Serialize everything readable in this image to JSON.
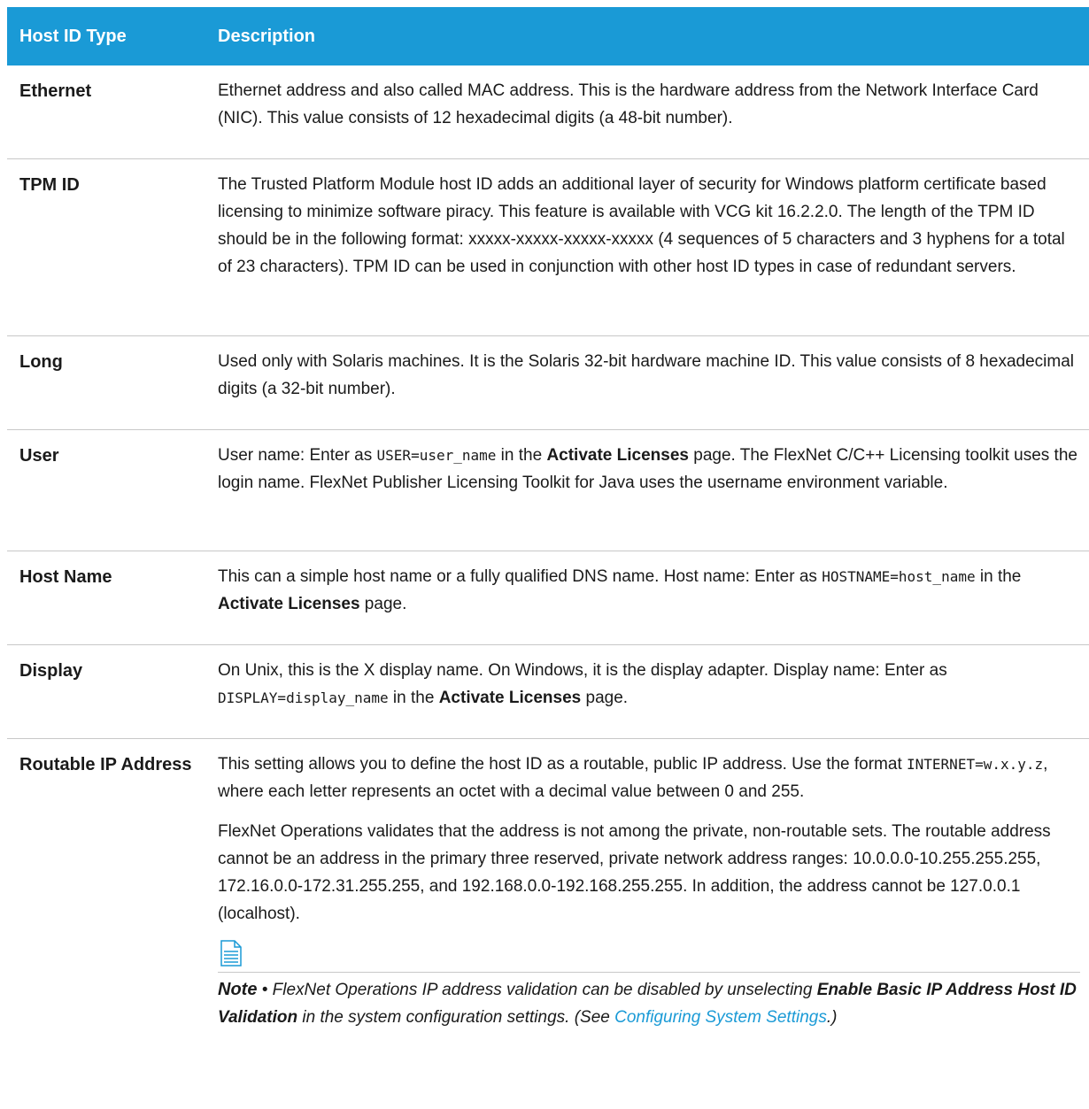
{
  "header": {
    "col1": "Host ID Type",
    "col2": "Description"
  },
  "rows": {
    "ethernet": {
      "type": "Ethernet",
      "desc": "Ethernet address and also called MAC address. This is the hardware address from the Network Interface Card (NIC). This value consists of 12 hexadecimal digits (a 48-bit number)."
    },
    "tpm": {
      "type": "TPM ID",
      "desc_a": "The Trusted Platform Module host ID adds an additional layer of security for Windows platform certificate based licensing to minimize software piracy. This feature is available with VCG kit 16.2.2.0. The length of the TPM ID should be in the following format: ",
      "format": "xxxxx-xxxxx-xxxxx-xxxxx",
      "desc_b": " (4 sequences of 5 characters and 3 hyphens for a total of 23 characters). TPM ID can be used in conjunction with other host ID types in case of redundant servers."
    },
    "long": {
      "type": "Long",
      "desc": "Used only with Solaris machines. It is the Solaris 32-bit hardware machine ID. This value consists of 8 hexadecimal digits (a 32-bit number)."
    },
    "user": {
      "type": "User",
      "desc_a": "User name: Enter as ",
      "code": "USER=user_name",
      "desc_b": "  in the ",
      "bold": "Activate Licenses",
      "desc_c": " page. The FlexNet C/C++ Licensing toolkit uses the login name. FlexNet Publisher Licensing Toolkit for Java uses the username environment variable."
    },
    "hostname": {
      "type": "Host Name",
      "desc_a": "This can a simple host name or a fully qualified DNS name. Host name: Enter as ",
      "code": "HOSTNAME=host_name",
      "desc_b": " in the ",
      "bold": "Activate Licenses",
      "desc_c": " page."
    },
    "display": {
      "type": "Display",
      "desc_a": "On Unix, this is the X display name. On Windows, it is the display adapter. Display name: Enter as ",
      "code": "DISPLAY=display_name",
      "desc_b": " in the ",
      "bold": "Activate Licenses",
      "desc_c": " page."
    },
    "routable": {
      "type": "Routable IP Address",
      "p1_a": "This setting allows you to define the host ID as a routable, public IP address. Use the format ",
      "p1_code": "INTERNET=w.x.y.z",
      "p1_b": ", where each letter represents an octet with a decimal value between 0 and 255.",
      "p2": "FlexNet Operations validates that the address is not among the private, non-routable sets. The routable address cannot be an address in the primary three reserved, private network address ranges: 10.0.0.0-10.255.255.255, 172.16.0.0-172.31.255.255, and 192.168.0.0-192.168.255.255. In addition, the address cannot be 127.0.0.1 (localhost).",
      "note_label": "Note",
      "note_a": " • FlexNet Operations IP address validation can be disabled by unselecting ",
      "note_bold": "Enable Basic IP Address Host ID Validation",
      "note_b": " in the system configuration settings. (See ",
      "note_link": "Configuring System Settings",
      "note_c": ".)"
    }
  },
  "colors": {
    "header_bg": "#1a9ad6",
    "link": "#1a9ad6",
    "rule": "#c8c8c8"
  },
  "icons": {
    "note": "note-document-icon"
  }
}
